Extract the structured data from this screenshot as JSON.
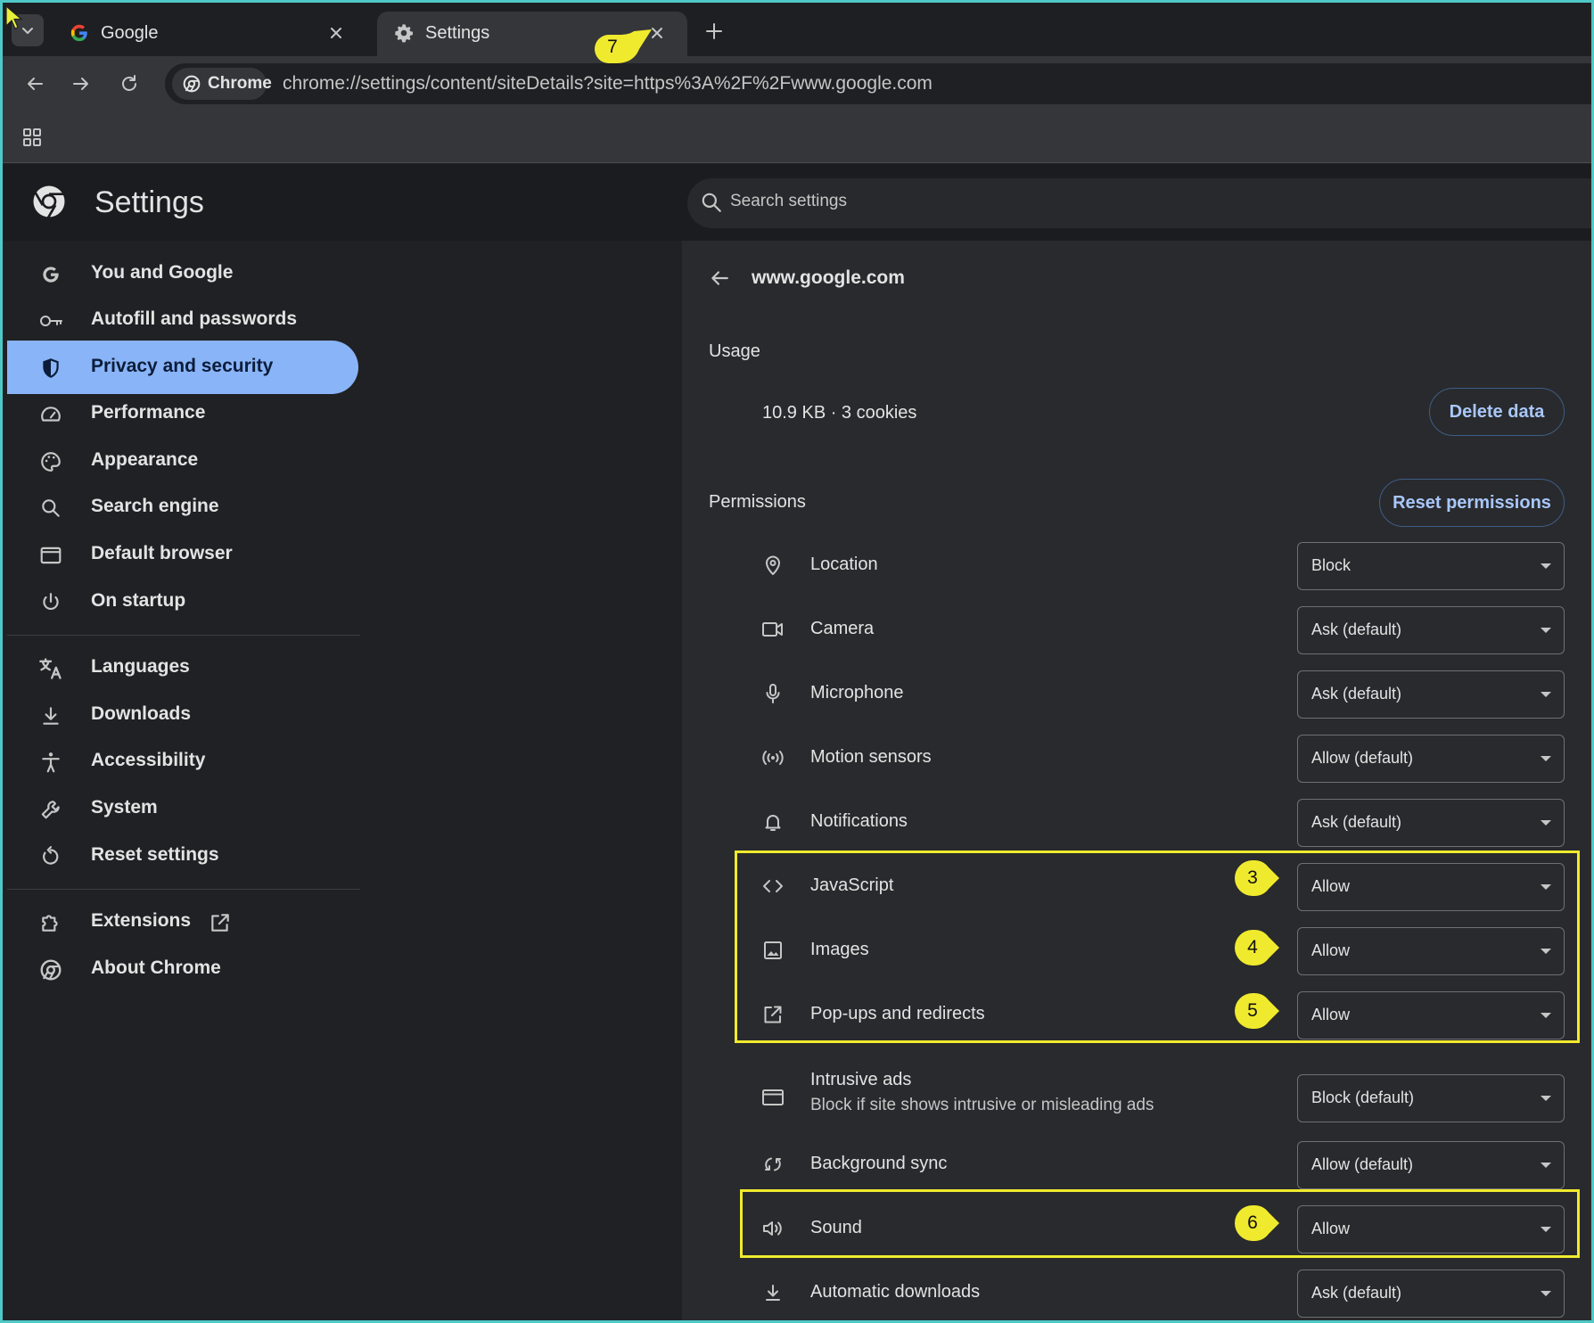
{
  "browser": {
    "tabs": [
      {
        "title": "Google",
        "active": false
      },
      {
        "title": "Settings",
        "active": true
      }
    ],
    "omnibox": {
      "chip": "Chrome",
      "url": "chrome://settings/content/siteDetails?site=https%3A%2F%2Fwww.google.com"
    }
  },
  "settings": {
    "title": "Settings",
    "search_placeholder": "Search settings",
    "nav": [
      {
        "label": "You and Google",
        "icon": "google-g-icon"
      },
      {
        "label": "Autofill and passwords",
        "icon": "key-icon"
      },
      {
        "label": "Privacy and security",
        "icon": "shield-icon",
        "active": true
      },
      {
        "label": "Performance",
        "icon": "speedometer-icon"
      },
      {
        "label": "Appearance",
        "icon": "palette-icon"
      },
      {
        "label": "Search engine",
        "icon": "search-icon"
      },
      {
        "label": "Default browser",
        "icon": "browser-window-icon"
      },
      {
        "label": "On startup",
        "icon": "power-icon"
      },
      {
        "label": "Languages",
        "icon": "translate-icon"
      },
      {
        "label": "Downloads",
        "icon": "download-icon"
      },
      {
        "label": "Accessibility",
        "icon": "accessibility-icon"
      },
      {
        "label": "System",
        "icon": "wrench-icon"
      },
      {
        "label": "Reset settings",
        "icon": "reset-icon"
      },
      {
        "label": "Extensions",
        "icon": "puzzle-icon"
      },
      {
        "label": "About Chrome",
        "icon": "chrome-icon"
      }
    ]
  },
  "site": {
    "name": "www.google.com",
    "usage_label": "Usage",
    "usage_value": "10.9 KB · 3 cookies",
    "delete_button": "Delete data",
    "permissions_label": "Permissions",
    "reset_button": "Reset permissions",
    "permissions": [
      {
        "label": "Location",
        "value": "Block",
        "icon": "location-pin-icon"
      },
      {
        "label": "Camera",
        "value": "Ask (default)",
        "icon": "camera-icon"
      },
      {
        "label": "Microphone",
        "value": "Ask (default)",
        "icon": "microphone-icon"
      },
      {
        "label": "Motion sensors",
        "value": "Allow (default)",
        "icon": "sensors-icon"
      },
      {
        "label": "Notifications",
        "value": "Ask (default)",
        "icon": "bell-icon"
      },
      {
        "label": "JavaScript",
        "value": "Allow",
        "icon": "code-icon"
      },
      {
        "label": "Images",
        "value": "Allow",
        "icon": "image-icon"
      },
      {
        "label": "Pop-ups and redirects",
        "value": "Allow",
        "icon": "open-external-icon"
      },
      {
        "label": "Intrusive ads",
        "sublabel": "Block if site shows intrusive or misleading ads",
        "value": "Block (default)",
        "icon": "ads-window-icon"
      },
      {
        "label": "Background sync",
        "value": "Allow (default)",
        "icon": "sync-icon"
      },
      {
        "label": "Sound",
        "value": "Allow",
        "icon": "speaker-icon"
      },
      {
        "label": "Automatic downloads",
        "value": "Ask (default)",
        "icon": "download-icon"
      }
    ]
  },
  "annotations": {
    "color": "#f0ea2e",
    "callouts": [
      "3",
      "4",
      "5",
      "6",
      "7"
    ]
  }
}
